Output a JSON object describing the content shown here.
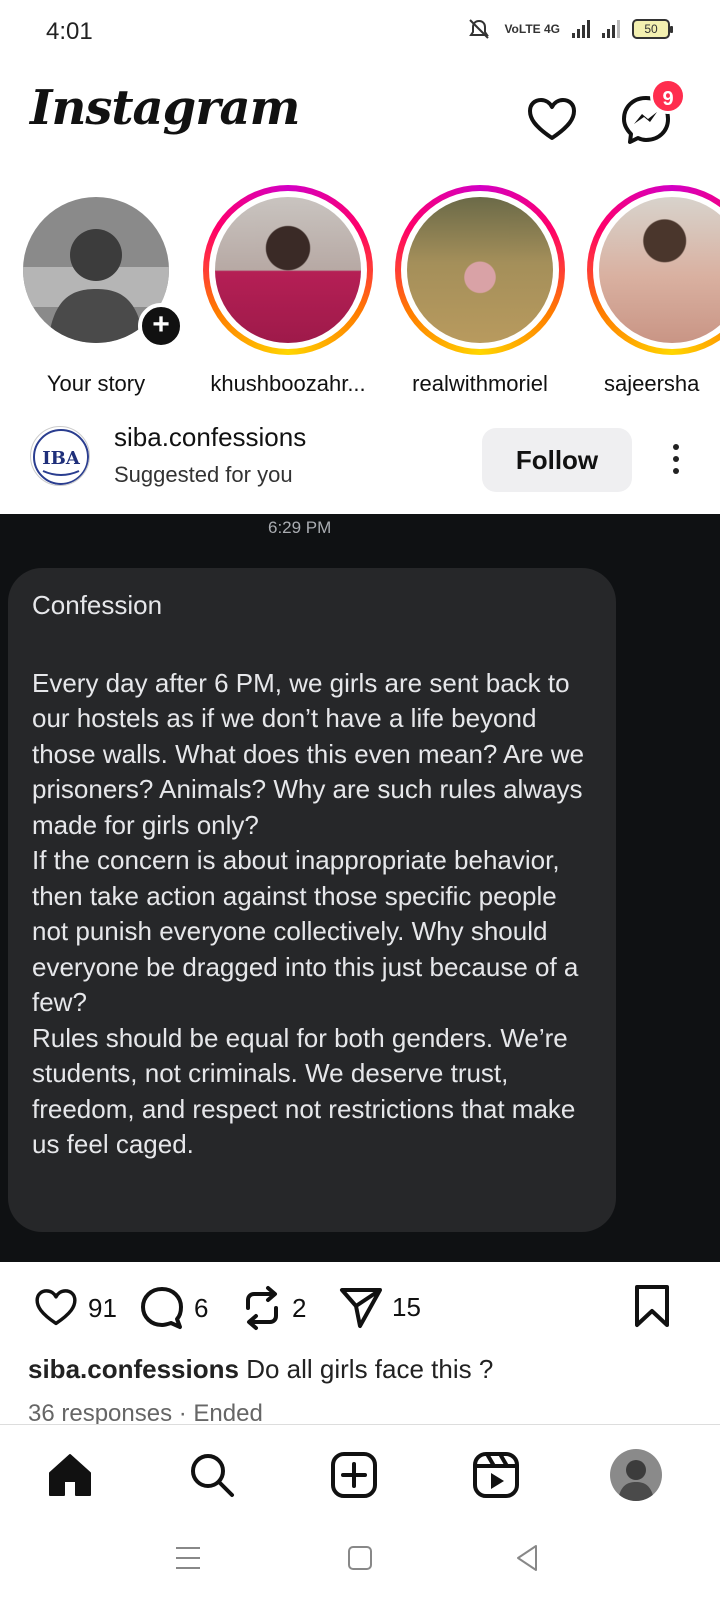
{
  "status_bar": {
    "time": "4:01",
    "network": "VoLTE 4G",
    "battery": "50"
  },
  "header": {
    "logo": "Instagram",
    "notif_badge": "9"
  },
  "stories": [
    {
      "name": "Your story"
    },
    {
      "name": "khushboozahr..."
    },
    {
      "name": "realwithmoriel"
    },
    {
      "name": "sajeersha"
    }
  ],
  "post": {
    "account": "siba.confessions",
    "subtitle": "Suggested for you",
    "follow_label": "Follow",
    "avatar_text": "IBA",
    "image": {
      "timestamp": "6:29 PM",
      "title": "Confession",
      "body": "Every day after 6 PM, we girls are sent back to our hostels as if we don’t have a life beyond those walls. What does this even mean? Are we prisoners? Animals? Why are such rules always made for girls only?\nIf the concern is about inappropriate behavior, then take action against those specific people not punish everyone collectively. Why should everyone be dragged into this just because of a few?\nRules should be equal for both genders. We’re students, not criminals. We deserve trust, freedom, and respect not restrictions that make us feel caged."
    },
    "likes": "91",
    "comments": "6",
    "reposts": "2",
    "shares": "15",
    "caption_user": "siba.confessions",
    "caption_text": "Do all girls face this ?",
    "responses": "36 responses · Ended"
  }
}
